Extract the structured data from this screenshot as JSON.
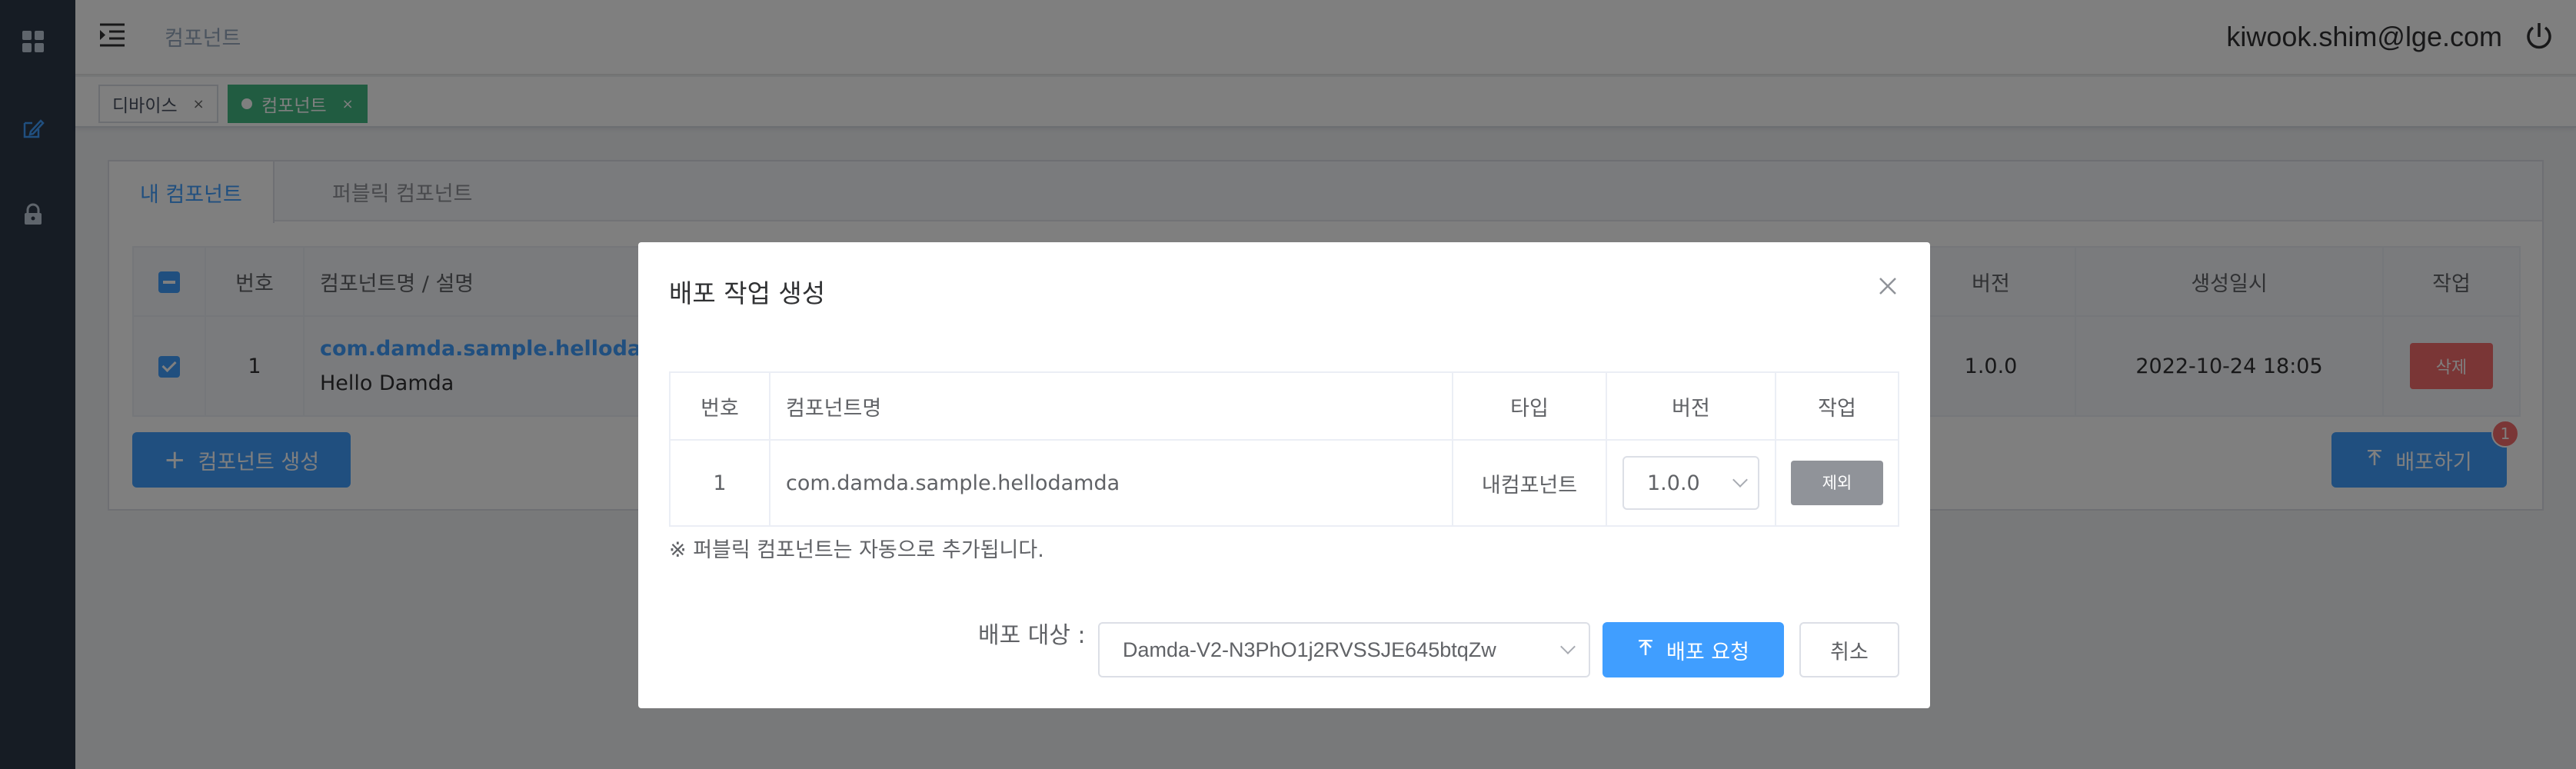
{
  "sidebar": {
    "icons": [
      "grid-icon",
      "edit-icon",
      "lock-icon"
    ]
  },
  "header": {
    "title": "컴포넌트",
    "user_email": "kiwook.shim@lge.com"
  },
  "tags": [
    {
      "label": "디바이스",
      "close": "×",
      "active": false
    },
    {
      "label": "컴포넌트",
      "close": "×",
      "active": true
    }
  ],
  "card": {
    "tabs": [
      "내 컴포넌트",
      "퍼블릭 컴포넌트"
    ],
    "table": {
      "headers": {
        "no": "번호",
        "name": "컴포넌트명 / 설명",
        "version": "버전",
        "created": "생성일시",
        "action": "작업"
      },
      "row": {
        "no": "1",
        "name": "com.damda.sample.hellodamda",
        "desc": "Hello Damda",
        "version": "1.0.0",
        "created": "2022-10-24 18:05",
        "action": "삭제"
      }
    },
    "create_button": "컴포넌트 생성",
    "deploy_button": "배포하기",
    "deploy_badge": "1"
  },
  "modal": {
    "title": "배포 작업 생성",
    "table": {
      "headers": {
        "no": "번호",
        "name": "컴포넌트명",
        "type": "타입",
        "version": "버전",
        "action": "작업"
      },
      "row": {
        "no": "1",
        "name": "com.damda.sample.hellodamda",
        "type": "내컴포넌트",
        "version": "1.0.0",
        "action": "제외"
      }
    },
    "note": "※ 퍼블릭 컴포넌트는 자동으로 추가됩니다.",
    "target_label": "배포 대상 :",
    "target_value": "Damda-V2-N3PhO1j2RVSSJE645btqZw",
    "deploy_request": "배포 요청",
    "cancel": "취소"
  },
  "colors": {
    "primary": "#409eff",
    "sidebar": "#2c3849",
    "active_tag": "#42b983",
    "danger": "#f56c6c",
    "gray_button": "#909399"
  }
}
